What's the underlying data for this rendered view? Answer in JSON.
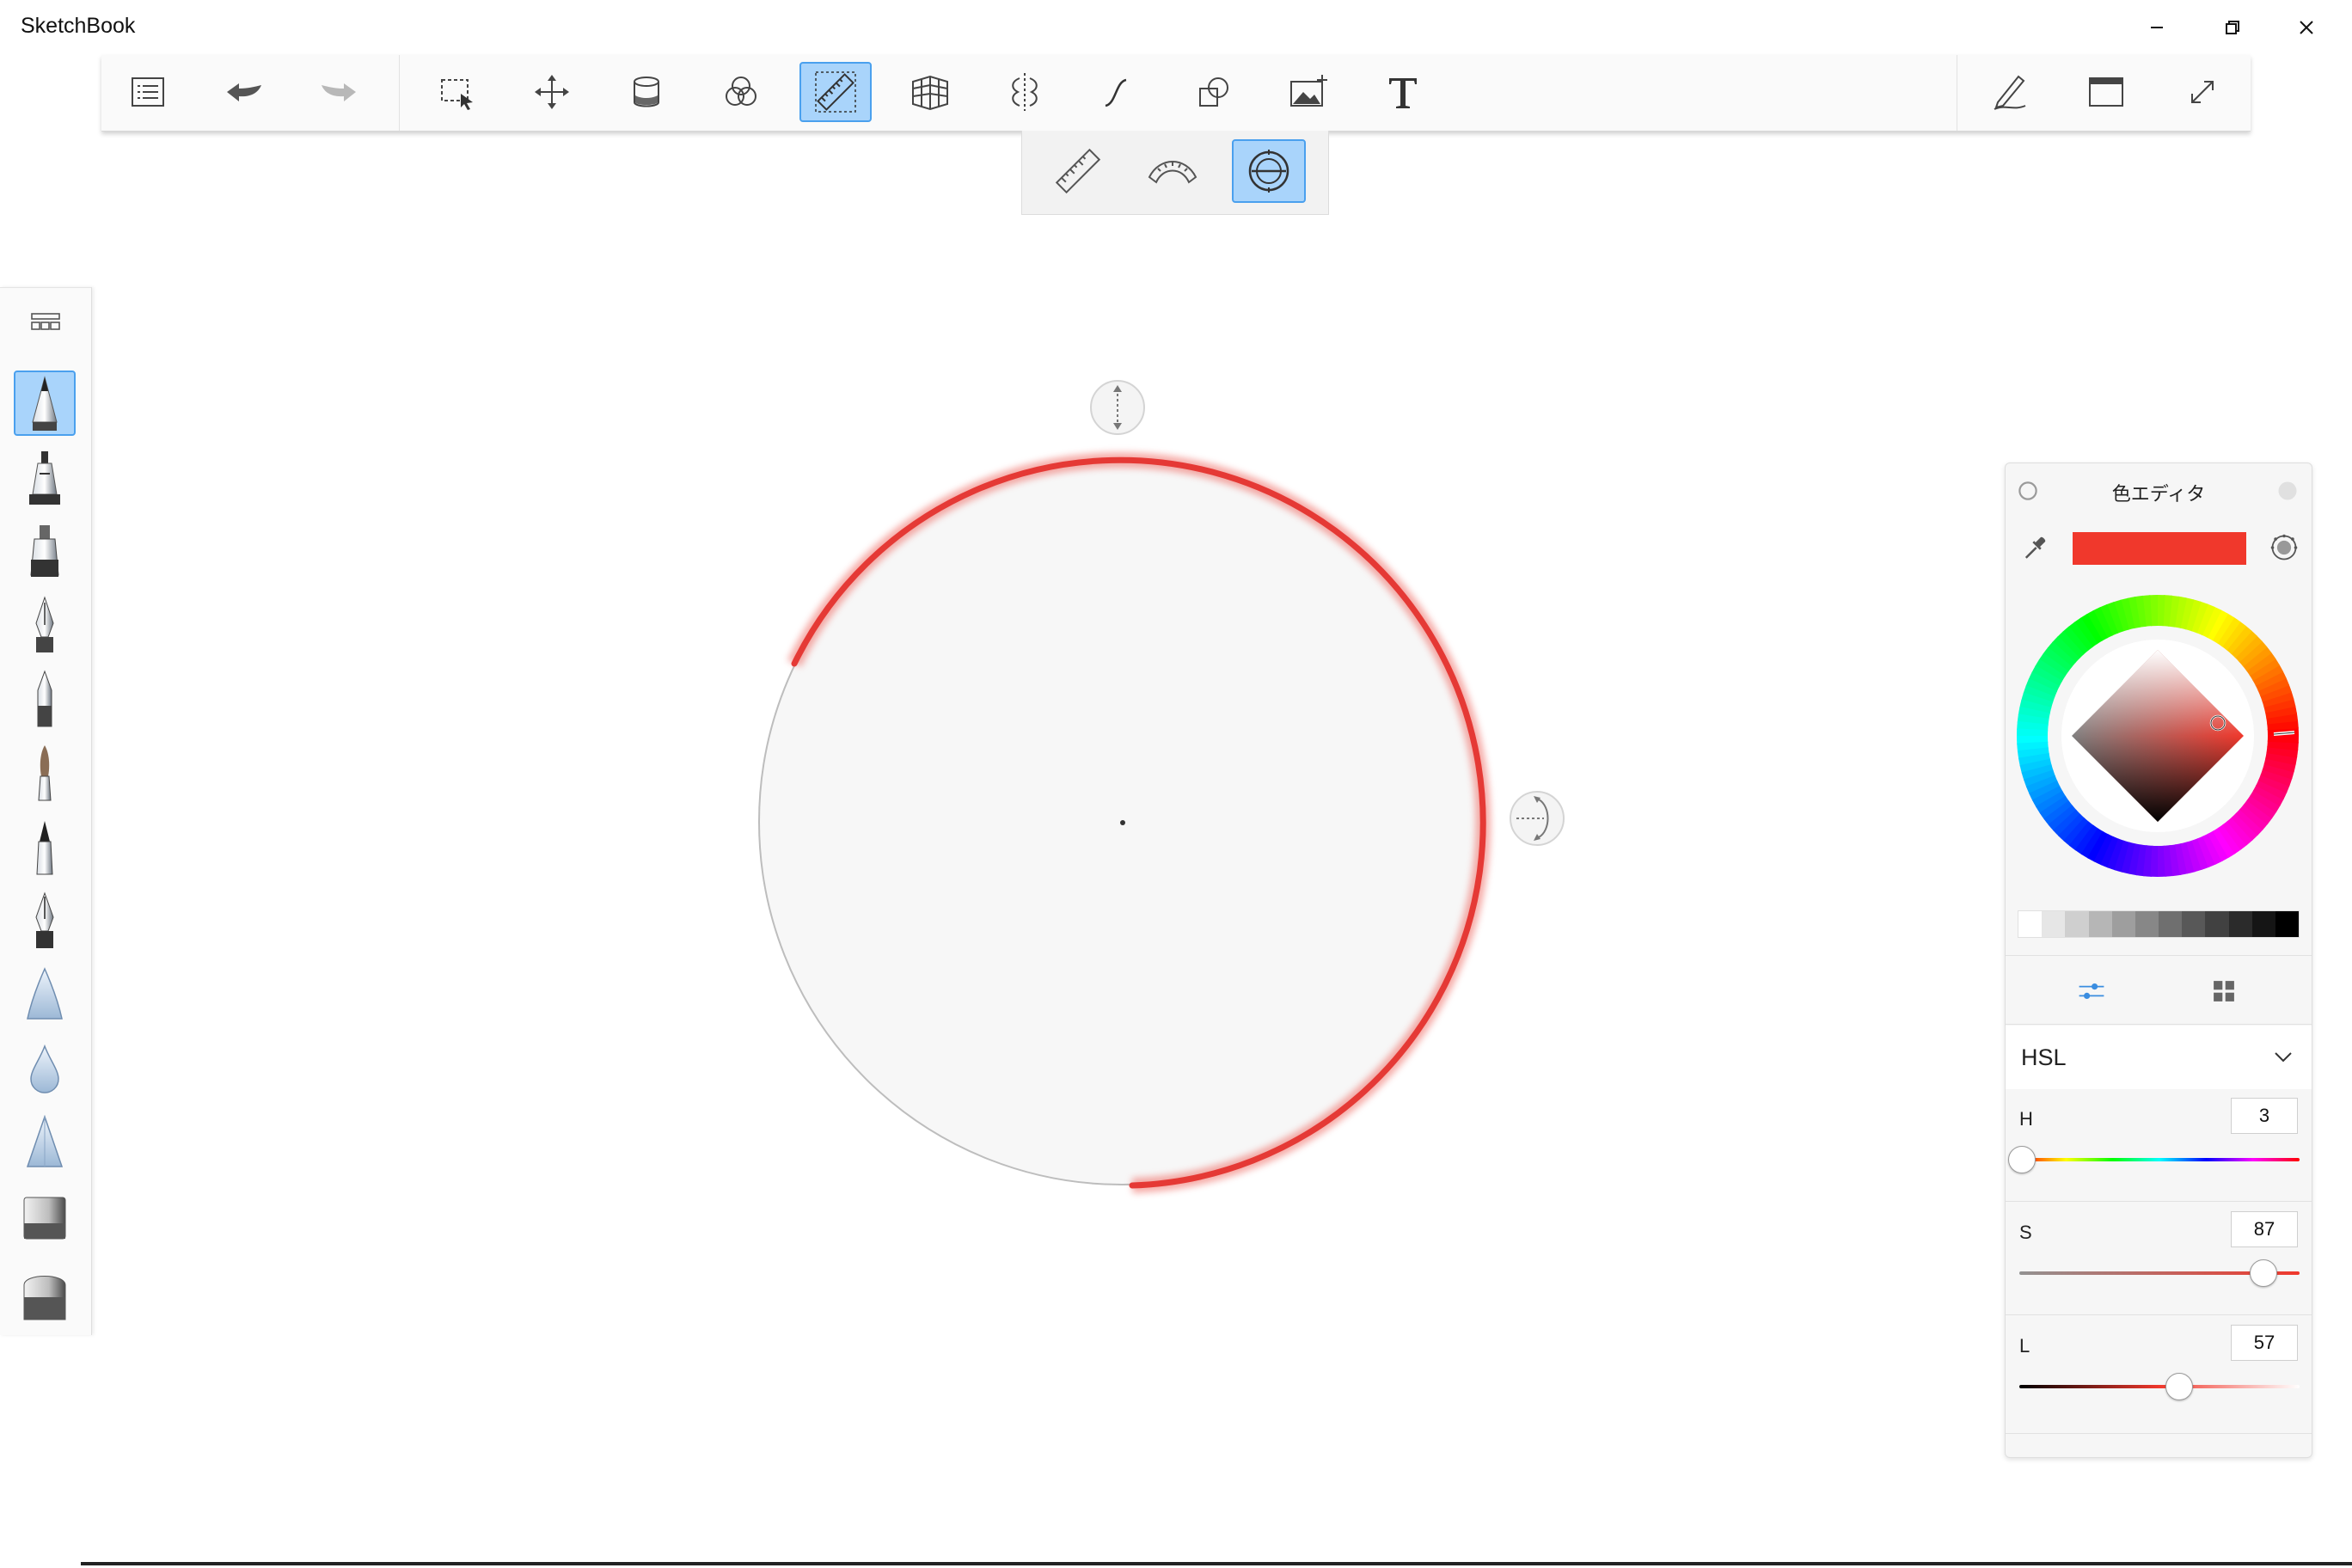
{
  "app": {
    "title": "SketchBook"
  },
  "window_controls": [
    "minimize-icon",
    "restore-icon",
    "close-icon"
  ],
  "toolbar": {
    "items": [
      {
        "name": "layer-list-button",
        "icon": "list-icon"
      },
      {
        "name": "undo-button",
        "icon": "undo-icon"
      },
      {
        "name": "redo-button",
        "icon": "redo-icon"
      },
      {
        "name": "selection-button",
        "icon": "selection-icon"
      },
      {
        "name": "transform-button",
        "icon": "move-icon"
      },
      {
        "name": "fill-button",
        "icon": "paint-bucket-icon"
      },
      {
        "name": "color-blend-button",
        "icon": "color-circles-icon"
      },
      {
        "name": "ruler-button",
        "icon": "ruler-icon",
        "active": true
      },
      {
        "name": "perspective-button",
        "icon": "perspective-grid-icon"
      },
      {
        "name": "symmetry-button",
        "icon": "symmetry-icon"
      },
      {
        "name": "stroke-curve-button",
        "icon": "curve-icon"
      },
      {
        "name": "shape-button",
        "icon": "shapes-icon"
      },
      {
        "name": "add-image-button",
        "icon": "add-image-icon"
      },
      {
        "name": "text-button",
        "icon": "text-icon"
      },
      {
        "name": "brush-properties-button",
        "icon": "pen-icon"
      },
      {
        "name": "window-mode-button",
        "icon": "window-icon"
      },
      {
        "name": "fullscreen-button",
        "icon": "expand-icon"
      }
    ]
  },
  "ruler_tools": [
    {
      "name": "straight-ruler-button",
      "icon": "ruler-icon"
    },
    {
      "name": "french-curve-button",
      "icon": "curve-ruler-icon"
    },
    {
      "name": "ellipse-guide-button",
      "icon": "ellipse-icon",
      "active": true
    }
  ],
  "brushes": {
    "selected_index": 0,
    "items": [
      "pencil",
      "airbrush",
      "marker",
      "ink-pen",
      "ballpoint",
      "paintbrush",
      "felt-pen",
      "technical-pen",
      "smudge",
      "water-drop",
      "blender",
      "hard-eraser",
      "soft-eraser"
    ]
  },
  "color_editor": {
    "title": "色エディタ",
    "current_color": "#f0382c",
    "model": "HSL",
    "sliders": [
      {
        "key": "h",
        "label": "H",
        "value": "3",
        "fraction": 0.01
      },
      {
        "key": "s",
        "label": "S",
        "value": "87",
        "fraction": 0.87
      },
      {
        "key": "l",
        "label": "L",
        "value": "57",
        "fraction": 0.57
      }
    ],
    "gray_swatches": [
      "#ffffff",
      "#e6e6e6",
      "#cfcfcf",
      "#b6b6b6",
      "#9e9e9e",
      "#878787",
      "#6f6f6f",
      "#585858",
      "#414141",
      "#2b2b2b",
      "#151515",
      "#000000"
    ]
  },
  "colors": {
    "accent": "#4aa0ee",
    "active_bg": "#a9d4fb",
    "stroke": "#e53935"
  }
}
